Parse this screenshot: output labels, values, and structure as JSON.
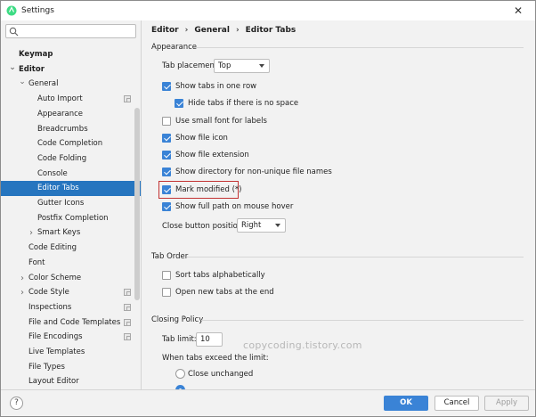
{
  "window": {
    "title": "Settings"
  },
  "search": {
    "placeholder": "",
    "value": ""
  },
  "sidebar": {
    "items": [
      {
        "label": "Keymap",
        "bold": true,
        "indent": 0,
        "arrow": "",
        "top": 0
      },
      {
        "label": "Editor",
        "bold": true,
        "indent": 0,
        "arrow": "down"
      },
      {
        "label": "General",
        "indent": 1,
        "arrow": "down"
      },
      {
        "label": "Auto Import",
        "indent": 2,
        "icon": true
      },
      {
        "label": "Appearance",
        "indent": 2
      },
      {
        "label": "Breadcrumbs",
        "indent": 2
      },
      {
        "label": "Code Completion",
        "indent": 2
      },
      {
        "label": "Code Folding",
        "indent": 2
      },
      {
        "label": "Console",
        "indent": 2
      },
      {
        "label": "Editor Tabs",
        "indent": 2,
        "selected": true
      },
      {
        "label": "Gutter Icons",
        "indent": 2
      },
      {
        "label": "Postfix Completion",
        "indent": 2
      },
      {
        "label": "Smart Keys",
        "indent": 2,
        "arrow": "right"
      },
      {
        "label": "Code Editing",
        "indent": 1
      },
      {
        "label": "Font",
        "indent": 1
      },
      {
        "label": "Color Scheme",
        "indent": 1,
        "arrow": "right"
      },
      {
        "label": "Code Style",
        "indent": 1,
        "arrow": "right",
        "icon": true
      },
      {
        "label": "Inspections",
        "indent": 1,
        "icon": true
      },
      {
        "label": "File and Code Templates",
        "indent": 1,
        "icon": true
      },
      {
        "label": "File Encodings",
        "indent": 1,
        "icon": true
      },
      {
        "label": "Live Templates",
        "indent": 1
      },
      {
        "label": "File Types",
        "indent": 1
      },
      {
        "label": "Layout Editor",
        "indent": 1
      }
    ]
  },
  "breadcrumb": {
    "part1": "Editor",
    "part2": "General",
    "part3": "Editor Tabs",
    "sep": "›"
  },
  "appearance": {
    "title": "Appearance",
    "tab_placement_label": "Tab placement:",
    "tab_placement_value": "Top",
    "show_tabs_one_row": "Show tabs in one row",
    "hide_tabs_no_space": "Hide tabs if there is no space",
    "small_font": "Use small font for labels",
    "show_file_icon": "Show file icon",
    "show_file_extension": "Show file extension",
    "show_directory": "Show directory for non-unique file names",
    "mark_modified": "Mark modified (*)",
    "show_full_path": "Show full path on mouse hover",
    "close_button_label": "Close button position:",
    "close_button_value": "Right"
  },
  "tab_order": {
    "title": "Tab Order",
    "sort_alpha": "Sort tabs alphabetically",
    "open_at_end": "Open new tabs at the end"
  },
  "closing_policy": {
    "title": "Closing Policy",
    "tab_limit_label": "Tab limit:",
    "tab_limit_value": "10",
    "exceed_label": "When tabs exceed the limit:",
    "close_unchanged": "Close unchanged"
  },
  "watermark": "copycoding.tistory.com",
  "footer": {
    "help": "?",
    "ok": "OK",
    "cancel": "Cancel",
    "apply": "Apply"
  },
  "colors": {
    "accent": "#3a83d6",
    "selection": "#2675bf",
    "highlight": "#c23232"
  }
}
